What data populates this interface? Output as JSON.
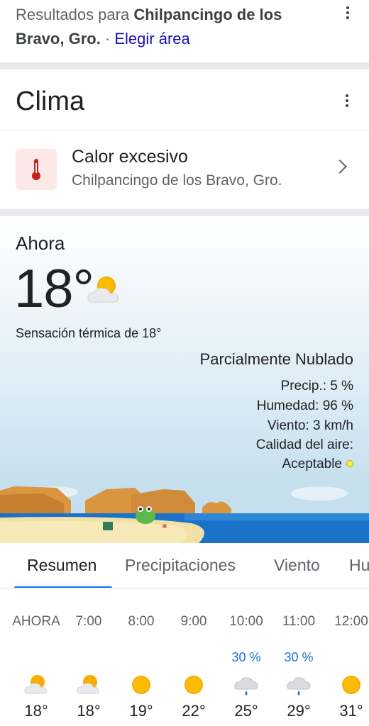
{
  "results": {
    "prefix": "Resultados para ",
    "place_line1": "Chilpancingo de los",
    "place_line2": "Bravo, Gro.",
    "separator": " · ",
    "link": "Elegir área"
  },
  "clima": {
    "title": "Clima"
  },
  "alert": {
    "title": "Calor excesivo",
    "location": "Chilpancingo de los Bravo, Gro.",
    "icon": "thermometer-icon"
  },
  "current": {
    "label": "Ahora",
    "temp": "18°",
    "icon": "partly-cloudy-icon",
    "feels_like": "Sensación térmica de 18°",
    "condition": "Parcialmente Nublado",
    "precip": "Precip.: 5 %",
    "humidity": "Humedad: 96 %",
    "wind": "Viento: 3 km/h",
    "air_quality_label": "Calidad del aire:",
    "air_quality_value": "Aceptable",
    "air_quality_color": "#ffeb3b"
  },
  "tabs": [
    "Resumen",
    "Precipitaciones",
    "Viento",
    "Hu"
  ],
  "active_tab": 0,
  "hourly": [
    {
      "time": "AHORA",
      "precip": "",
      "icon": "partly-cloudy-icon",
      "temp": "18°"
    },
    {
      "time": "7:00",
      "precip": "",
      "icon": "partly-cloudy-icon",
      "temp": "18°"
    },
    {
      "time": "8:00",
      "precip": "",
      "icon": "sun-icon",
      "temp": "19°"
    },
    {
      "time": "9:00",
      "precip": "",
      "icon": "sun-icon",
      "temp": "22°"
    },
    {
      "time": "10:00",
      "precip": "30 %",
      "icon": "rain-cloud-icon",
      "temp": "25°"
    },
    {
      "time": "11:00",
      "precip": "30 %",
      "icon": "rain-cloud-icon",
      "temp": "29°"
    },
    {
      "time": "12:00",
      "precip": "",
      "icon": "sun-icon",
      "temp": "31°"
    }
  ],
  "colors": {
    "accent": "#1a73e8",
    "link": "#1a0dab",
    "alert_bg": "#fce8e6",
    "alert_icon": "#c5221f",
    "sun": "#f9ab00"
  }
}
